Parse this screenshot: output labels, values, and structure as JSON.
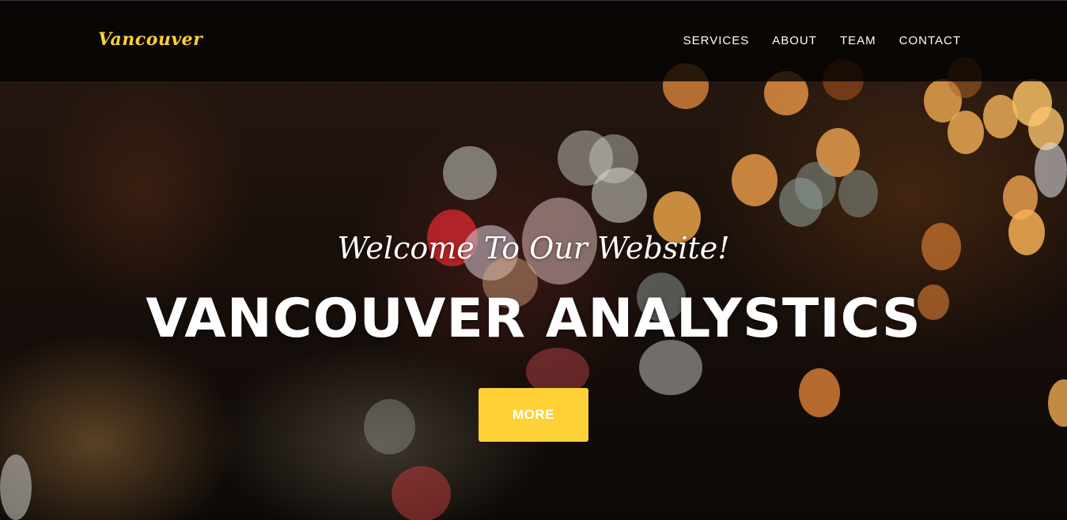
{
  "navbar": {
    "brand": "Vancouver",
    "links": [
      "SERVICES",
      "ABOUT",
      "TEAM",
      "CONTACT"
    ]
  },
  "hero": {
    "lead": "Welcome To Our Website!",
    "heading": "VANCOUVER ANALYSTICS",
    "button_label": "MORE",
    "background": "blurred rainy window with bokeh city lights"
  },
  "colors": {
    "accent": "#fed136",
    "text": "#ffffff",
    "navbar_bg": "#000000"
  }
}
